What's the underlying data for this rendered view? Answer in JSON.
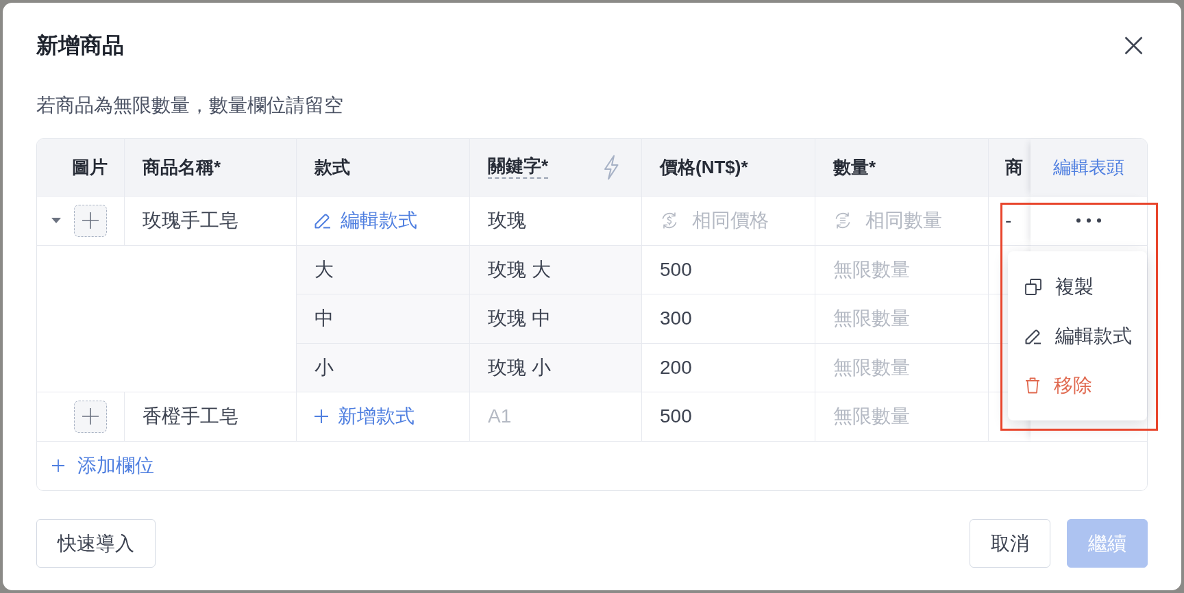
{
  "dialog": {
    "title": "新增商品",
    "hint": "若商品為無限數量，數量欄位請留空"
  },
  "table": {
    "columns": [
      {
        "label": "圖片",
        "kind": "image"
      },
      {
        "label": "商品名稱*",
        "kind": "text"
      },
      {
        "label": "款式",
        "kind": "text"
      },
      {
        "label": "關鍵字*",
        "kind": "hint"
      },
      {
        "label": "價格(NT$)*",
        "kind": "text"
      },
      {
        "label": "數量*",
        "kind": "text"
      },
      {
        "label": "商",
        "kind": "text"
      }
    ],
    "header_action": "編輯表頭",
    "rows": [
      {
        "expanded": true,
        "name": "玫瑰手工皂",
        "variant_action": {
          "kind": "edit",
          "label": "編輯款式"
        },
        "keyword": {
          "value": "玫瑰"
        },
        "price": {
          "placeholder": "相同價格",
          "kind": "linked"
        },
        "quantity": {
          "placeholder": "相同數量",
          "kind": "linked"
        },
        "column_7": {
          "value": "-"
        },
        "menu": {
          "open": true,
          "highlighted": true,
          "items": [
            {
              "kind": "copy",
              "label": "複製"
            },
            {
              "kind": "edit",
              "label": "編輯款式"
            },
            {
              "kind": "delete",
              "label": "移除"
            }
          ]
        },
        "variants": [
          {
            "name": "大",
            "keyword": {
              "value": "玫瑰 大"
            },
            "price": {
              "value": "500"
            },
            "quantity": {
              "placeholder": "無限數量"
            }
          },
          {
            "name": "中",
            "keyword": {
              "value": "玫瑰 中"
            },
            "price": {
              "value": "300"
            },
            "quantity": {
              "placeholder": "無限數量"
            }
          },
          {
            "name": "小",
            "keyword": {
              "value": "玫瑰 小"
            },
            "price": {
              "value": "200"
            },
            "quantity": {
              "placeholder": "無限數量"
            }
          }
        ]
      },
      {
        "name": "香橙手工皂",
        "variant_action": {
          "kind": "add",
          "label": "新增款式"
        },
        "keyword": {
          "placeholder": "A1"
        },
        "price": {
          "value": "500"
        },
        "quantity": {
          "placeholder": "無限數量"
        }
      }
    ],
    "add_column": "添加欄位"
  },
  "footer": {
    "left_buttons": [
      {
        "label": "快速導入",
        "kind": "secondary",
        "disabled": false
      }
    ],
    "right_buttons": [
      {
        "label": "取消",
        "kind": "secondary",
        "disabled": false
      },
      {
        "label": "繼續",
        "kind": "primary",
        "disabled": true
      }
    ]
  }
}
